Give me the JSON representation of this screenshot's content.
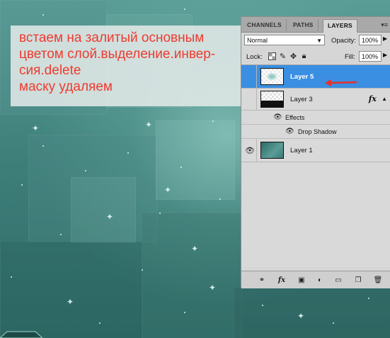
{
  "note": {
    "lines": [
      "встаем на залитый основным",
      "цветом слой.выделение.инвер-",
      "сия.delete",
      "маску удаляем"
    ],
    "color": "#ef3b2f"
  },
  "panel": {
    "tabs": [
      "CHANNELS",
      "PATHS",
      "LAYERS"
    ],
    "active_tab": "LAYERS",
    "blend_mode": "Normal",
    "opacity_label": "Opacity:",
    "opacity_value": "100%",
    "lock_label": "Lock:",
    "fill_label": "Fill:",
    "fill_value": "100%",
    "layers": [
      {
        "name": "Layer 5",
        "selected": true,
        "visible": false
      },
      {
        "name": "Layer 3",
        "selected": false,
        "visible": false,
        "fx": "fx"
      },
      {
        "name": "Layer 1",
        "selected": false,
        "visible": true
      }
    ],
    "effects_label": "Effects",
    "drop_shadow_label": "Drop Shadow",
    "selection_color": "#3b8fe3"
  }
}
